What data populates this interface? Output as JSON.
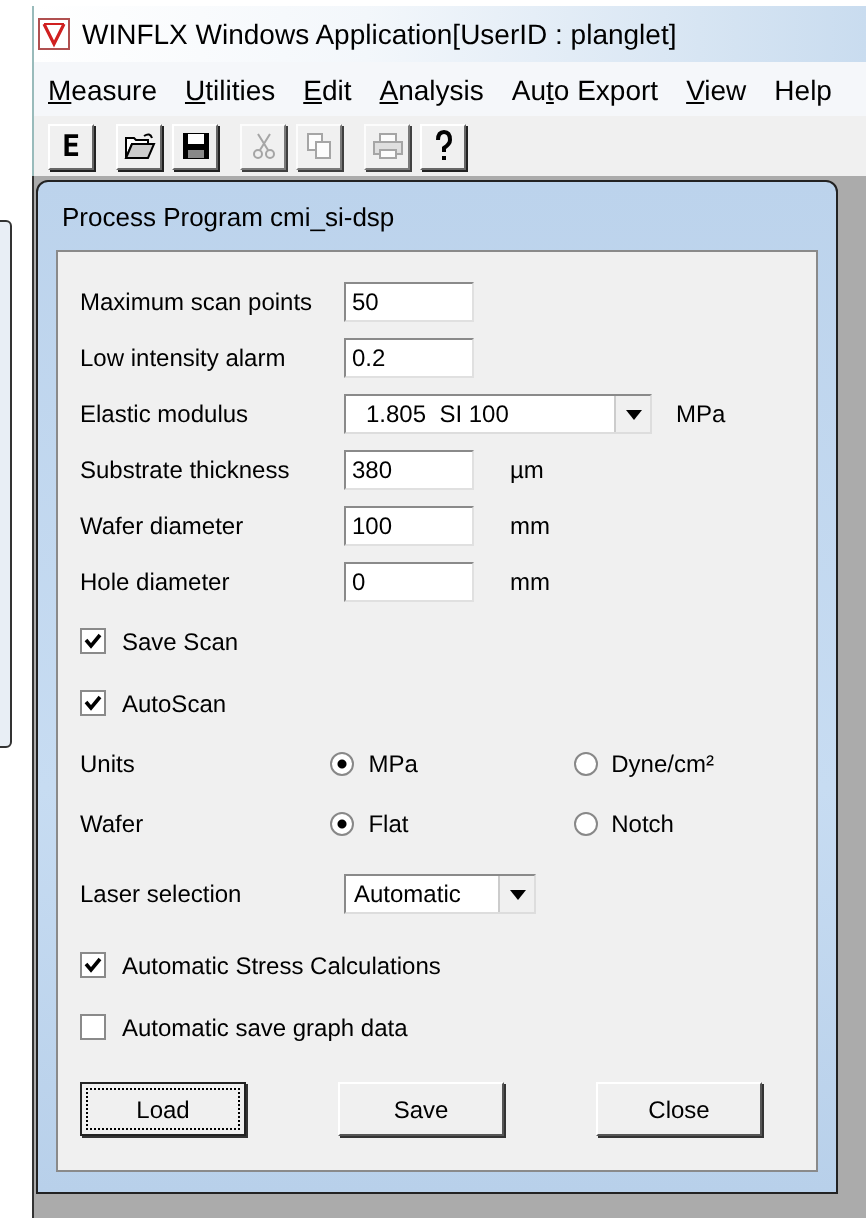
{
  "window": {
    "title": "WINFLX Windows Application[UserID : planglet]"
  },
  "menu": [
    {
      "key": "M",
      "post": "easure"
    },
    {
      "key": "U",
      "post": "tilities"
    },
    {
      "key": "E",
      "post": "dit"
    },
    {
      "key": "A",
      "post": "nalysis"
    },
    {
      "pre": "Au",
      "key": "t",
      "post": "o Export"
    },
    {
      "key": "V",
      "post": "iew"
    },
    {
      "pre": "Help"
    }
  ],
  "toolbar": [
    [
      {
        "kind": "letter",
        "text": "E",
        "disabled": false
      }
    ],
    [
      {
        "kind": "open",
        "disabled": false
      },
      {
        "kind": "save",
        "disabled": false
      }
    ],
    [
      {
        "kind": "cut",
        "disabled": true
      },
      {
        "kind": "copy",
        "disabled": true
      }
    ],
    [
      {
        "kind": "print",
        "disabled": true
      },
      {
        "kind": "help",
        "disabled": false
      }
    ]
  ],
  "dialog": {
    "title": "Process Program cmi_si-dsp",
    "rows": [
      {
        "kind": "field",
        "label": "Maximum scan points",
        "value": "50"
      },
      {
        "kind": "field",
        "label": "Low intensity alarm",
        "value": "0.2"
      },
      {
        "kind": "combo",
        "label": "Elastic modulus",
        "value": "1.805  SI 100",
        "unit": "MPa"
      },
      {
        "kind": "field",
        "label": "Substrate thickness",
        "value": "380",
        "unit": "µm"
      },
      {
        "kind": "field",
        "label": "Wafer diameter",
        "value": "100",
        "unit": "mm"
      },
      {
        "kind": "field",
        "label": "Hole diameter",
        "value": "0",
        "unit": "mm"
      },
      {
        "kind": "checkbox",
        "label": "Save Scan",
        "checked": true
      },
      {
        "kind": "checkbox",
        "label": "AutoScan",
        "checked": true
      },
      {
        "kind": "radio",
        "label": "Units",
        "options": [
          {
            "label": "MPa",
            "selected": true
          },
          {
            "label": "Dyne/cm²",
            "selected": false
          }
        ]
      },
      {
        "kind": "radio",
        "label": "Wafer",
        "options": [
          {
            "label": "Flat",
            "selected": true
          },
          {
            "label": "Notch",
            "selected": false
          }
        ]
      },
      {
        "kind": "select",
        "label": "Laser selection",
        "value": "Automatic"
      },
      {
        "kind": "checkbox",
        "label": "Automatic Stress Calculations",
        "checked": true
      },
      {
        "kind": "checkbox",
        "label": "Automatic save graph data",
        "checked": false
      }
    ],
    "buttons": [
      {
        "label": "Load",
        "focused": true
      },
      {
        "label": "Save",
        "focused": false
      },
      {
        "label": "Close",
        "focused": false
      }
    ]
  }
}
